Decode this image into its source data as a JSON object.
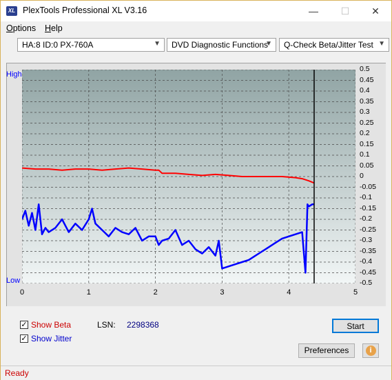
{
  "titlebar": {
    "app_icon_text": "XL",
    "title": "PlexTools Professional XL V3.16",
    "minimize": "—",
    "maximize": "☐",
    "close": "✕"
  },
  "menu": {
    "options": "ptions",
    "options_accel": "O",
    "help": "elp",
    "help_accel": "H"
  },
  "toolbar": {
    "drive": "HA:8 ID:0  PX-760A",
    "function": "DVD Diagnostic Functions",
    "test": "Q-Check Beta/Jitter Test"
  },
  "chart_labels": {
    "high": "High",
    "low": "Low"
  },
  "chart_data": {
    "type": "line",
    "title": "",
    "xlabel": "",
    "ylabel": "",
    "xlim": [
      0,
      5
    ],
    "ylim_right": [
      -0.5,
      0.5
    ],
    "x_ticks": [
      "0",
      "1",
      "2",
      "3",
      "4",
      "5"
    ],
    "y_ticks_right": [
      "0.5",
      "0.45",
      "0.4",
      "0.35",
      "0.3",
      "0.25",
      "0.2",
      "0.15",
      "0.1",
      "0.05",
      "0",
      "-0.05",
      "-0.1",
      "-0.15",
      "-0.2",
      "-0.25",
      "-0.3",
      "-0.35",
      "-0.4",
      "-0.45",
      "-0.5"
    ],
    "grid": true,
    "end_marker_x": 4.38,
    "series": [
      {
        "color": "#ff0000",
        "x": [
          0,
          0.2,
          0.4,
          0.6,
          0.8,
          1.0,
          1.2,
          1.4,
          1.6,
          1.8,
          2.0,
          2.05,
          2.1,
          2.3,
          2.5,
          2.7,
          2.9,
          3.1,
          3.3,
          3.5,
          3.7,
          3.9,
          4.1,
          4.2,
          4.3,
          4.38
        ],
        "values": [
          0.04,
          0.035,
          0.035,
          0.03,
          0.035,
          0.035,
          0.03,
          0.035,
          0.04,
          0.035,
          0.03,
          0.03,
          0.015,
          0.015,
          0.01,
          0.005,
          0.01,
          0.005,
          0.0,
          0.0,
          0.0,
          0.0,
          -0.005,
          -0.01,
          -0.02,
          -0.03
        ]
      },
      {
        "color": "#0000ff",
        "x": [
          0,
          0.05,
          0.1,
          0.15,
          0.2,
          0.25,
          0.3,
          0.35,
          0.4,
          0.5,
          0.6,
          0.7,
          0.8,
          0.9,
          1.0,
          1.05,
          1.1,
          1.2,
          1.3,
          1.4,
          1.5,
          1.6,
          1.7,
          1.8,
          1.9,
          2.0,
          2.05,
          2.1,
          2.2,
          2.3,
          2.4,
          2.5,
          2.6,
          2.7,
          2.8,
          2.9,
          2.95,
          3.0,
          3.1,
          3.2,
          3.3,
          3.4,
          3.5,
          3.6,
          3.7,
          3.8,
          3.9,
          4.0,
          4.1,
          4.2,
          4.25,
          4.28,
          4.3,
          4.35,
          4.38
        ],
        "values": [
          -0.2,
          -0.16,
          -0.23,
          -0.17,
          -0.25,
          -0.13,
          -0.27,
          -0.24,
          -0.26,
          -0.24,
          -0.2,
          -0.26,
          -0.22,
          -0.25,
          -0.2,
          -0.15,
          -0.22,
          -0.25,
          -0.28,
          -0.24,
          -0.26,
          -0.27,
          -0.24,
          -0.3,
          -0.28,
          -0.28,
          -0.32,
          -0.3,
          -0.29,
          -0.25,
          -0.32,
          -0.3,
          -0.34,
          -0.36,
          -0.33,
          -0.37,
          -0.3,
          -0.43,
          -0.42,
          -0.41,
          -0.4,
          -0.39,
          -0.37,
          -0.35,
          -0.33,
          -0.31,
          -0.29,
          -0.28,
          -0.27,
          -0.26,
          -0.45,
          -0.13,
          -0.14,
          -0.13,
          -0.13
        ]
      }
    ]
  },
  "options": {
    "show_beta": "Show Beta",
    "show_jitter": "Show Jitter",
    "show_beta_checked": "✓",
    "show_jitter_checked": "✓",
    "lsn_label": "LSN:",
    "lsn_value": "2298368"
  },
  "buttons": {
    "start": "Start",
    "preferences": "Preferences",
    "info": "i"
  },
  "colors": {
    "beta": "#ff0000",
    "jitter": "#0000ff",
    "plot_bg_top": "#90a4a4",
    "plot_bg_bottom": "#f2f6f6",
    "status_text": "#cc0000"
  },
  "status": {
    "text": "Ready"
  }
}
